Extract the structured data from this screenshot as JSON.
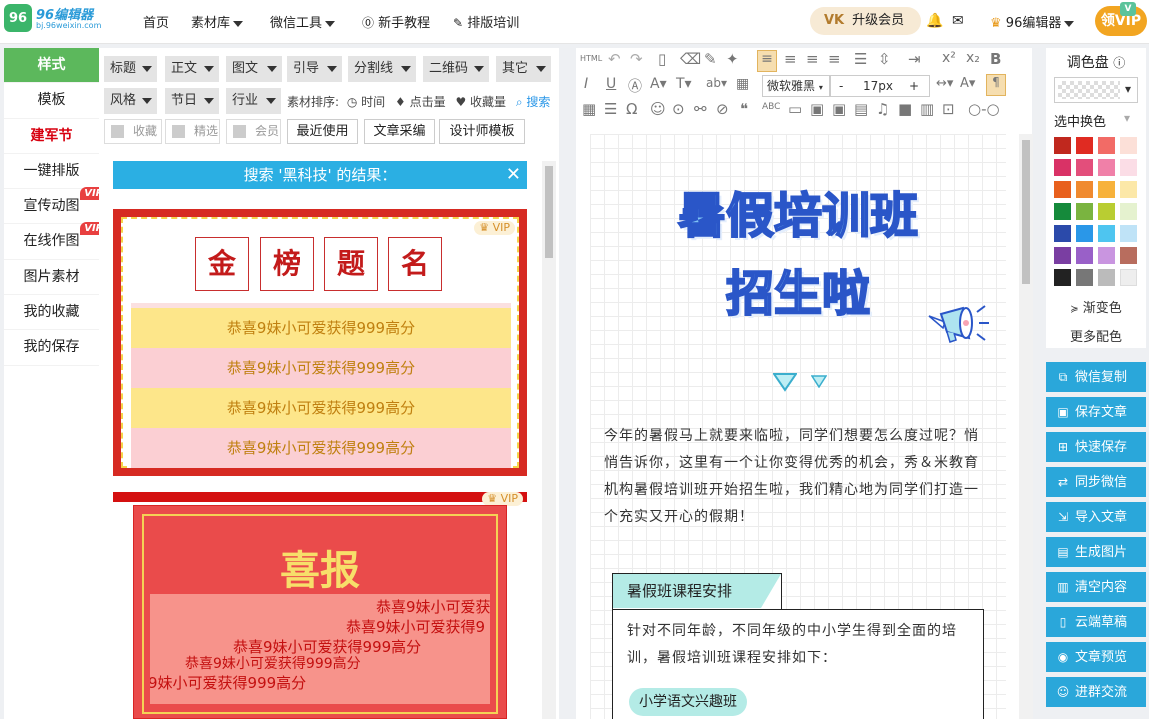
{
  "app": {
    "logo_mark": "96",
    "logo_name": "96编辑器",
    "logo_url": "bj.96weixin.com"
  },
  "topnav": {
    "home": "首页",
    "materials": "素材库",
    "wechat_tools": "微信工具",
    "tutorial": "新手教程",
    "layout_training": "排版培训",
    "upgrade": "升级会员",
    "upgrade_badge": "VK",
    "user": "96编辑器",
    "vip": "领VIP",
    "vip_badge": "V"
  },
  "sidebar": {
    "items": [
      {
        "label": "样式",
        "vip": ""
      },
      {
        "label": "模板",
        "vip": ""
      },
      {
        "label": "建军节",
        "vip": ""
      },
      {
        "label": "一键排版",
        "vip": ""
      },
      {
        "label": "宣传动图",
        "vip": "VIP"
      },
      {
        "label": "在线作图",
        "vip": "VIP"
      },
      {
        "label": "图片素材",
        "vip": ""
      },
      {
        "label": "我的收藏",
        "vip": ""
      },
      {
        "label": "我的保存",
        "vip": ""
      }
    ]
  },
  "materials": {
    "dropdowns": [
      "标题",
      "正文",
      "图文",
      "引导",
      "分割线",
      "二维码",
      "其它",
      "风格",
      "节日",
      "行业"
    ],
    "sort_label": "素材排序:",
    "sort_time": "时间",
    "sort_clicks": "点击量",
    "sort_fav": "收藏量",
    "search": "搜索",
    "filters": [
      "收藏",
      "精选",
      "会员"
    ],
    "buttons": [
      "最近使用",
      "文章采编",
      "设计师模板"
    ],
    "search_result": "搜索 '黑科技' 的结果：",
    "vip_tag": "VIP",
    "card1_chars": [
      "金",
      "榜",
      "题",
      "名"
    ],
    "card1_lines": [
      "恭喜9妹小可爱获得999高分",
      "恭喜9妹小可爱获得999高分",
      "恭喜9妹小可爱获得999高分",
      "恭喜9妹小可爱获得999高分"
    ],
    "card2_title": "喜报",
    "card2_lines": [
      "恭喜9妹小可爱获",
      "恭喜9妹小可爱获得9",
      "恭喜9妹小可爱获得999高分",
      "恭喜9妹小可爱获得999高分",
      "9妹小可爱获得999高分"
    ]
  },
  "editor": {
    "html_label": "HTML",
    "font_family": "微软雅黑",
    "font_size": "17px",
    "minus": "-",
    "plus": "+",
    "title_line1": "暑假培训班",
    "title_line2": "招生啦",
    "paragraph": "今年的暑假马上就要来临啦，同学们想要怎么度过呢？悄悄告诉你，这里有一个让你变得优秀的机会，秀＆米教育机构暑假培训班开始招生啦，我们精心地为同学们打造一个充实又开心的假期！",
    "course_header": "暑假班课程安排",
    "course_text": "针对不同年龄，不同年级的中小学生得到全面的培训，暑假培训班课程安排如下：",
    "course_pill": "小学语文兴趣班"
  },
  "palette": {
    "title": "调色盘",
    "selected_label": "选中换色",
    "gradient": "渐变色",
    "more": "更多配色",
    "colors": [
      "#c0281e",
      "#e02b22",
      "#f26b66",
      "#fce0d8",
      "#d93266",
      "#e34e7b",
      "#f080a8",
      "#fbdde6",
      "#e8601d",
      "#f08a2f",
      "#f7b23b",
      "#fce8a8",
      "#158a3b",
      "#7ab440",
      "#b9cd32",
      "#e5f2cf",
      "#2b4aaa",
      "#2a97e8",
      "#4ec5f0",
      "#bfe3f7",
      "#7a3ea2",
      "#9960c8",
      "#c995e0",
      "#b86d5e",
      "#222222",
      "#777777",
      "#bbbbbb",
      "#eeeeee"
    ]
  },
  "actions": [
    {
      "label": "微信复制",
      "icon": "copy-icon"
    },
    {
      "label": "保存文章",
      "icon": "save-icon"
    },
    {
      "label": "快速保存",
      "icon": "plus-box-icon"
    },
    {
      "label": "同步微信",
      "icon": "sync-icon"
    },
    {
      "label": "导入文章",
      "icon": "import-icon"
    },
    {
      "label": "生成图片",
      "icon": "image-icon"
    },
    {
      "label": "清空内容",
      "icon": "trash-icon"
    },
    {
      "label": "云端草稿",
      "icon": "document-icon"
    },
    {
      "label": "文章预览",
      "icon": "eye-icon"
    },
    {
      "label": "进群交流",
      "icon": "group-icon"
    }
  ]
}
